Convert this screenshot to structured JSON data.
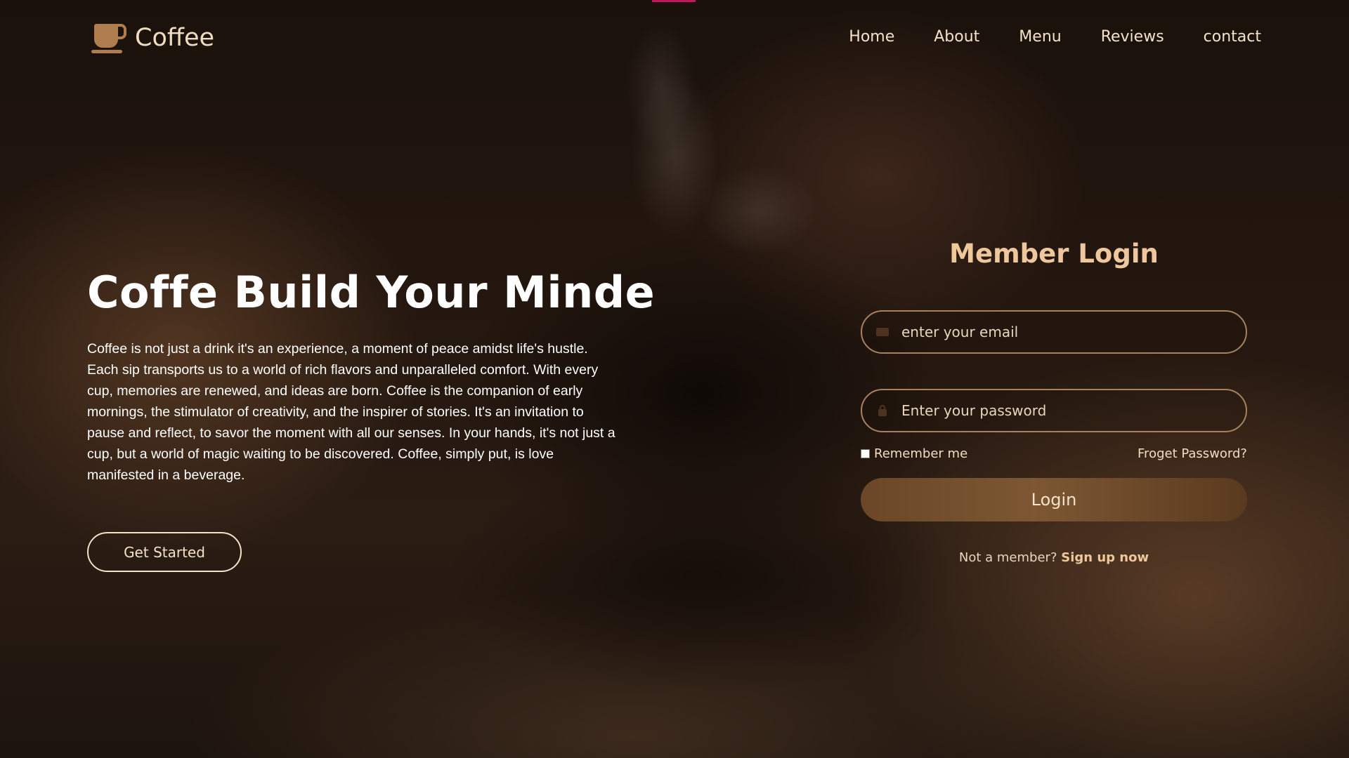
{
  "brand": {
    "name": "Coffee",
    "icon": "coffee-cup-icon"
  },
  "nav": {
    "items": [
      "Home",
      "About",
      "Menu",
      "Reviews",
      "contact"
    ]
  },
  "hero": {
    "title": "Coffe Build Your Minde",
    "description": "Coffee is not just a drink it's an experience, a moment of peace amidst life's hustle. Each sip transports us to a world of rich flavors and unparalleled comfort. With every cup, memories are renewed, and ideas are born. Coffee is the companion of early mornings, the stimulator of creativity, and the inspirer of stories. It's an invitation to pause and reflect, to savor the moment with all our senses. In your hands, it's not just a cup, but a world of magic waiting to be discovered. Coffee, simply put, is love manifested in a beverage.",
    "cta_label": "Get Started"
  },
  "login": {
    "title": "Member Login",
    "email_placeholder": "enter your email",
    "email_icon": "envelope-icon",
    "password_placeholder": "Enter your password",
    "password_icon": "lock-icon",
    "remember_label": "Remember me",
    "forgot_label": "Froget Password?",
    "submit_label": "Login",
    "signup_prompt": "Not a member?",
    "signup_link": "Sign up now"
  },
  "colors": {
    "accent": "#efc79c",
    "button": "#7d5733",
    "field_border": "#a6825f",
    "top_accent": "#c2185b"
  }
}
